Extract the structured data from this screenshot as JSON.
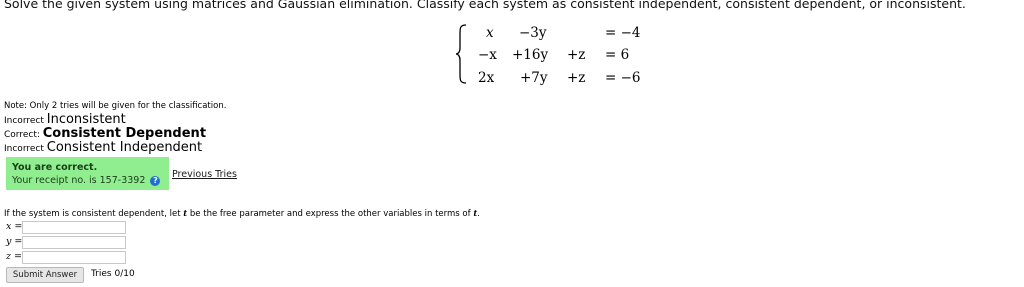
{
  "question": "Solve the given system using matrices and Gaussian elimination. Classify each system as consistent independent, consistent dependent, or inconsistent.",
  "system": {
    "rows": [
      [
        "x",
        "−3y",
        "",
        "= −4"
      ],
      [
        "−x",
        "+16y",
        "+z",
        "= 6"
      ],
      [
        "2x",
        "+7y",
        "+z",
        "= −6"
      ]
    ]
  },
  "note": "Note: Only 2 tries will be given for the classification.",
  "classification": [
    {
      "status": "Incorrect",
      "option": "Inconsistent"
    },
    {
      "status": "Correct:",
      "option": "Consistent Dependent"
    },
    {
      "status": "Incorrect",
      "option": "Consistent Independent"
    }
  ],
  "receipt": {
    "title": "You are correct.",
    "text": "Your receipt no. is 157-3392",
    "help_icon": "?"
  },
  "previous_tries": "Previous Tries",
  "instructions": {
    "before": "If the system is consistent dependent, let ",
    "param": "t",
    "middle": " be the free parameter and express the other variables in terms of ",
    "after": "."
  },
  "answers": [
    {
      "var": "x",
      "eq": " =",
      "value": ""
    },
    {
      "var": "y",
      "eq": " =",
      "value": ""
    },
    {
      "var": "z",
      "eq": " =",
      "value": ""
    }
  ],
  "submit_label": "Submit Answer",
  "tries_text": "Tries 0/10",
  "colors": {
    "correct_bg": "#90ee90",
    "help_icon": "#1e6fd0"
  }
}
